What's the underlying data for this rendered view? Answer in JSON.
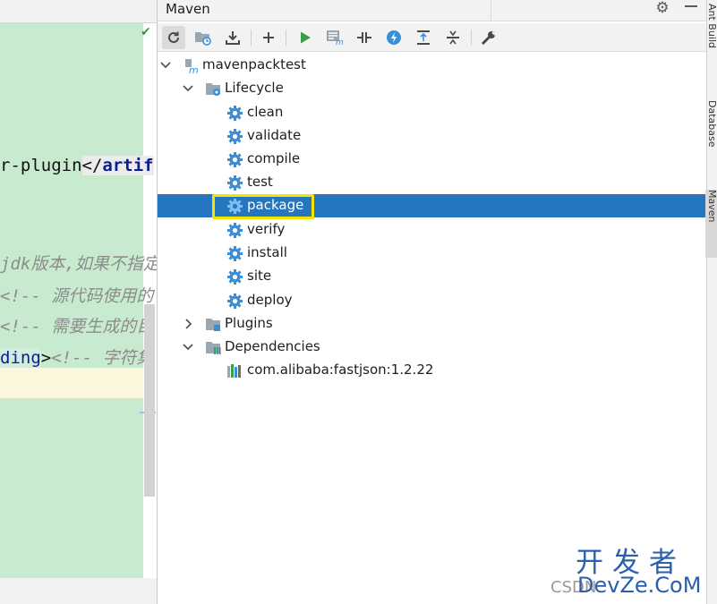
{
  "editor": {
    "line1_prefix": "r-plugin",
    "line1_close_open": "</",
    "line1_tag": "artif",
    "line2_comment": "jdk版本,如果不指定",
    "line3_comment": "<!-- 源代码使用的",
    "line4_comment": "<!-- 需要生成的目",
    "line5_tag": "ding",
    "line5_gt": ">",
    "line5_comment": "<!-- 字符集"
  },
  "maven": {
    "title": "Maven",
    "toolbar": [
      {
        "name": "reload-all-maven-projects",
        "icon": "refresh-icon"
      },
      {
        "name": "generate-sources-and-update-folders",
        "icon": "folder-refresh-icon"
      },
      {
        "name": "download-sources-and-documentation",
        "icon": "download-icon"
      },
      {
        "name": "add-maven-projects",
        "icon": "plus-icon"
      },
      {
        "name": "run-maven-build",
        "icon": "run-icon"
      },
      {
        "name": "execute-maven-goal",
        "icon": "maven-goal-icon"
      },
      {
        "name": "toggle-offline-mode",
        "icon": "offline-icon"
      },
      {
        "name": "toggle-skip-tests-mode",
        "icon": "lightning-icon"
      },
      {
        "name": "show-dependencies",
        "icon": "expand-icon"
      },
      {
        "name": "collapse-all",
        "icon": "collapse-icon"
      },
      {
        "name": "maven-settings",
        "icon": "wrench-icon"
      }
    ],
    "tree": {
      "project": "mavenpacktest",
      "lifecycle_label": "Lifecycle",
      "lifecycle": [
        "clean",
        "validate",
        "compile",
        "test",
        "package",
        "verify",
        "install",
        "site",
        "deploy"
      ],
      "selected": "package",
      "plugins_label": "Plugins",
      "dependencies_label": "Dependencies",
      "dependencies": [
        "com.alibaba:fastjson:1.2.22"
      ]
    }
  },
  "right_strip": {
    "tabs": [
      "Ant Build",
      "Database",
      "Maven"
    ]
  },
  "watermark": {
    "line1": "开发者",
    "line2": "DevZe.CoM",
    "csdn": "CSDN"
  },
  "colors": {
    "selection": "#2675bf",
    "highlight_box": "#f5e400",
    "gear": "#3a8fd9",
    "editor_green": "#c8ebcf"
  }
}
